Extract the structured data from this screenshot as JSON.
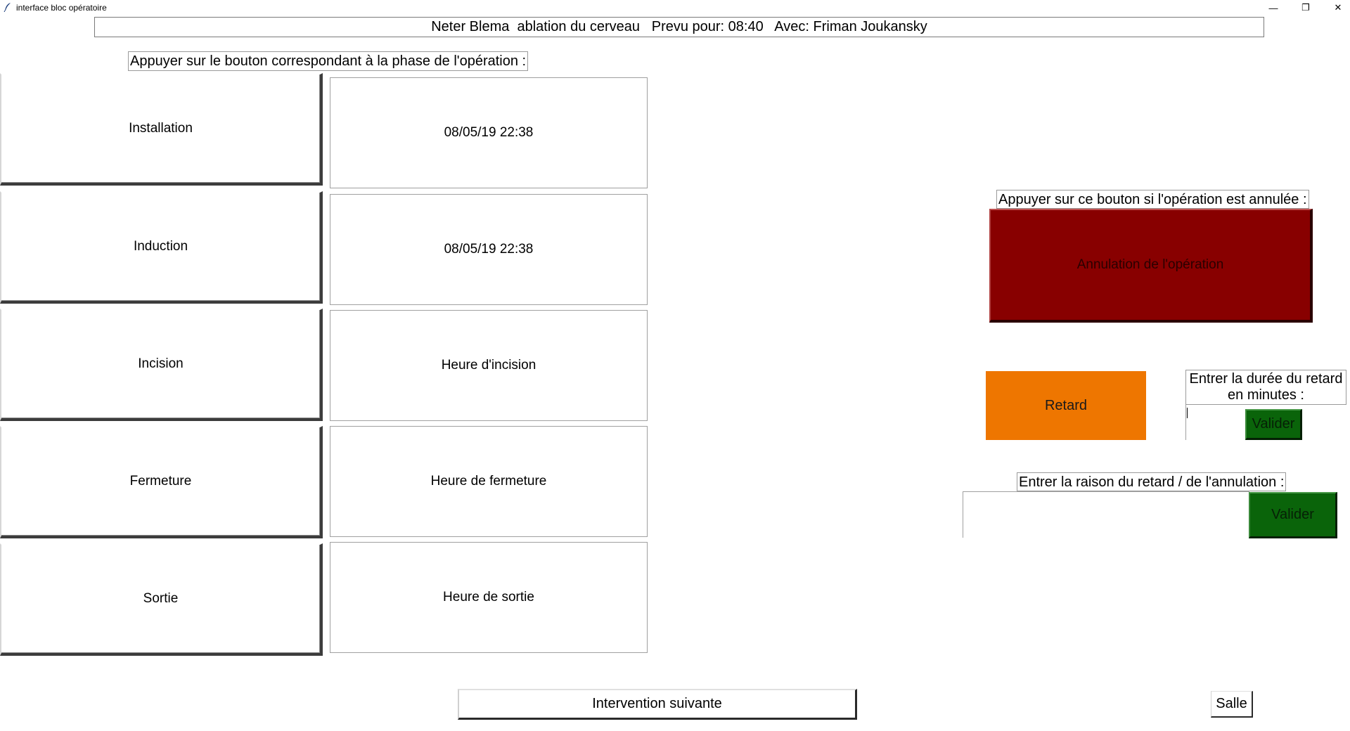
{
  "window": {
    "title": "interface bloc opératoire",
    "app_icon": "feather-icon",
    "controls": {
      "minimize": "—",
      "maximize": "❐",
      "close": "✕"
    }
  },
  "header": {
    "text": "Neter Blema  ablation du cerveau   Prevu pour: 08:40   Avec: Friman Joukansky"
  },
  "phases": {
    "instruction": "Appuyer sur le bouton correspondant à la phase de l'opération :",
    "items": [
      {
        "label": "Installation",
        "time": "08/05/19 22:38"
      },
      {
        "label": "Induction",
        "time": "08/05/19 22:38"
      },
      {
        "label": "Incision",
        "time": "Heure d'incision"
      },
      {
        "label": "Fermeture",
        "time": "Heure de fermeture"
      },
      {
        "label": "Sortie",
        "time": "Heure de sortie"
      }
    ]
  },
  "cancellation": {
    "instruction": "Appuyer sur ce bouton si l'opération est annulée :",
    "button_label": "Annulation de l'opération",
    "color": "#880000"
  },
  "delay": {
    "button_label": "Retard",
    "color": "#ee7600",
    "duration_label_line1": "Entrer la durée du retard",
    "duration_label_line2": "en minutes :",
    "duration_value": "",
    "validate_label": "Valider"
  },
  "reason": {
    "label": "Entrer la raison du retard / de l'annulation :",
    "value": "",
    "validate_label": "Valider",
    "validate_color": "#0a640a"
  },
  "footer": {
    "next_label": "Intervention suivante",
    "room_label": "Salle"
  }
}
